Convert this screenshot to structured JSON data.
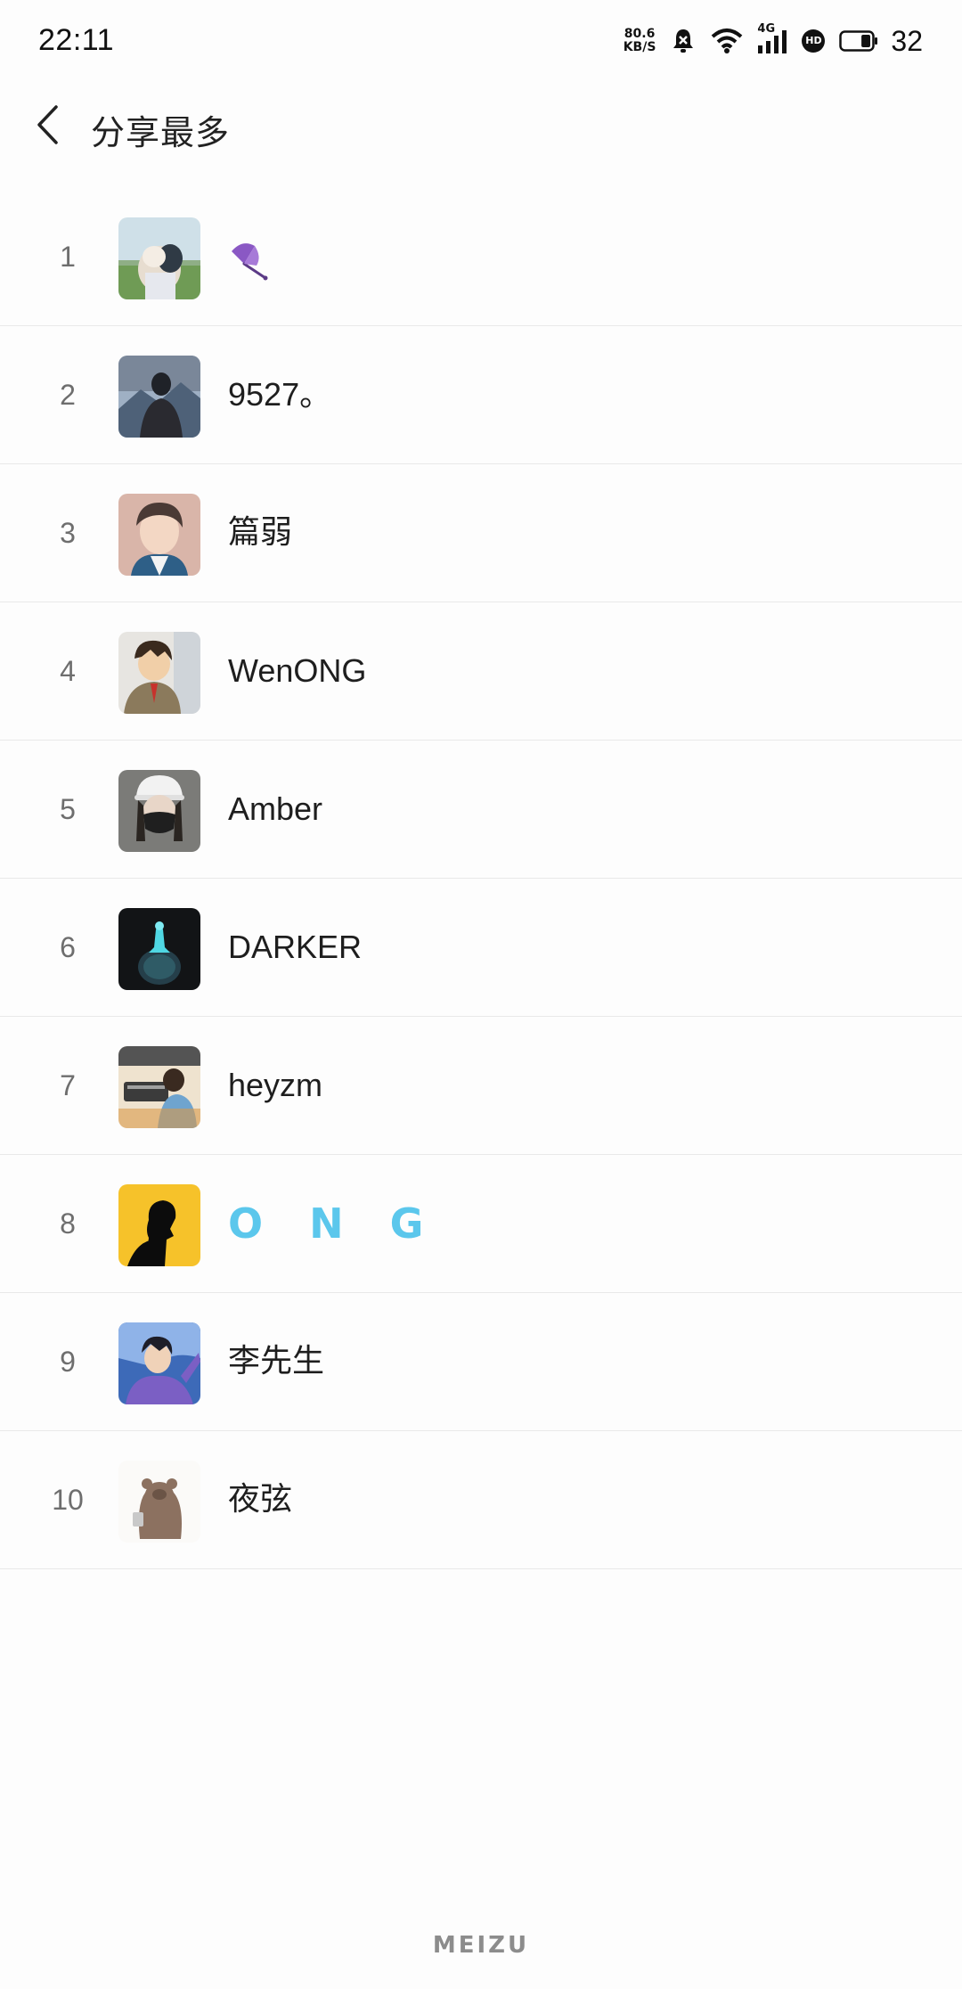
{
  "status_bar": {
    "time": "22:11",
    "net_speed_value": "80.6",
    "net_speed_unit": "KB/S",
    "signal_label": "4G",
    "hd_label": "HD",
    "battery_level": "32",
    "battery_fraction": 0.32
  },
  "header": {
    "title": "分享最多"
  },
  "list": [
    {
      "rank": "1",
      "name": "",
      "name_icon": "umbrella-icon",
      "avatar": "avatar-girl-with-dog"
    },
    {
      "rank": "2",
      "name": "9527。",
      "avatar": "avatar-man-mountain"
    },
    {
      "rank": "3",
      "name": "篇弱",
      "avatar": "avatar-anime-boy"
    },
    {
      "rank": "4",
      "name": "WenONG",
      "avatar": "avatar-anime-student"
    },
    {
      "rank": "5",
      "name": "Amber",
      "avatar": "avatar-girl-mask-cap"
    },
    {
      "rank": "6",
      "name": "DARKER",
      "avatar": "avatar-dark-glow-figure"
    },
    {
      "rank": "7",
      "name": "heyzm",
      "avatar": "avatar-desk-illustration"
    },
    {
      "rank": "8",
      "name": "O N G",
      "avatar": "avatar-silhouette-yellow"
    },
    {
      "rank": "9",
      "name": "李先生",
      "avatar": "avatar-anime-man"
    },
    {
      "rank": "10",
      "name": "夜弦",
      "avatar": "avatar-bear"
    }
  ],
  "footer": {
    "brand": "MEIZU"
  },
  "colors": {
    "background": "#fdfdfd",
    "divider": "#e9e9e9",
    "rank_number": "#6e6e6e",
    "ong_accent": "#5bc7ec",
    "umbrella": "#8a58c4"
  }
}
